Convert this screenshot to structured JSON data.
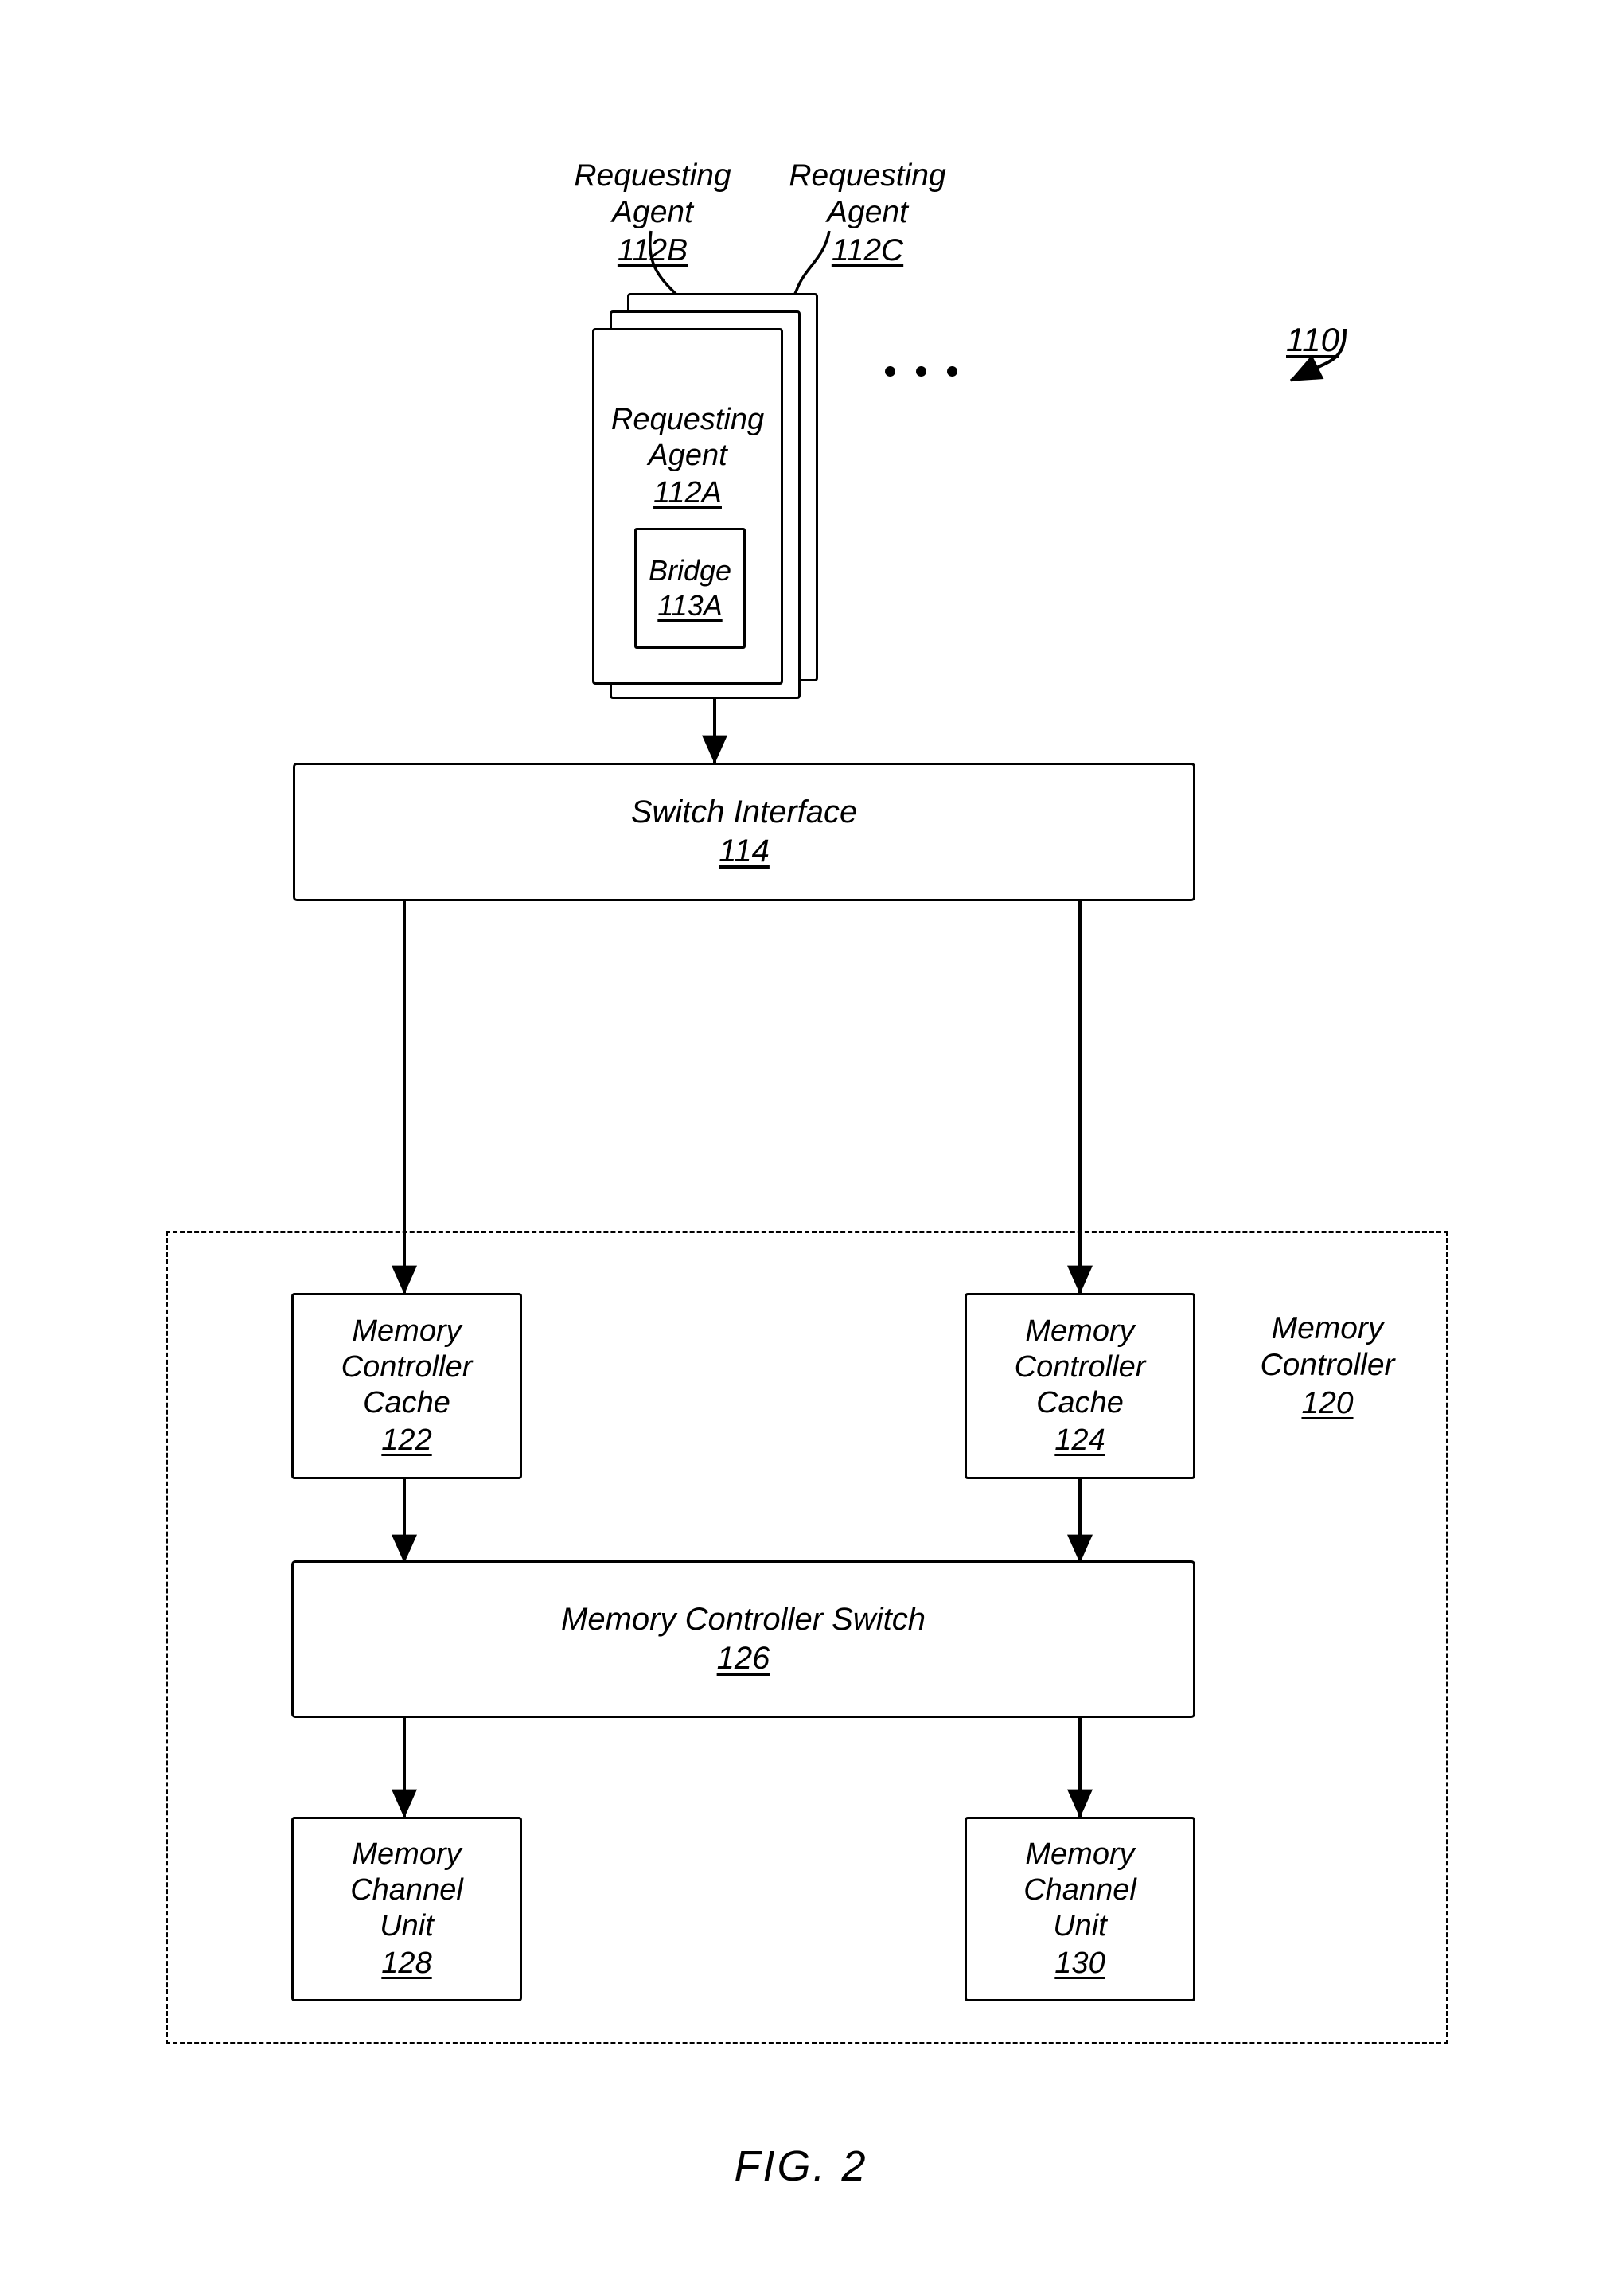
{
  "figure": {
    "caption": "FIG. 2",
    "system_ref": "110"
  },
  "top_labels": [
    {
      "title": "Requesting\nAgent",
      "ref": "112B"
    },
    {
      "title": "Requesting\nAgent",
      "ref": "112C"
    }
  ],
  "requesting_agent": {
    "title": "Requesting\nAgent",
    "ref": "112A",
    "bridge": {
      "title": "Bridge",
      "ref": "113A"
    },
    "ellipsis": "• • •"
  },
  "switch_interface": {
    "title": "Switch Interface",
    "ref": "114"
  },
  "memory_controller": {
    "title": "Memory\nController",
    "ref": "120",
    "caches": [
      {
        "title": "Memory\nController\nCache",
        "ref": "122"
      },
      {
        "title": "Memory\nController\nCache",
        "ref": "124"
      }
    ],
    "switch": {
      "title": "Memory Controller Switch",
      "ref": "126"
    },
    "channel_units": [
      {
        "title": "Memory\nChannel\nUnit",
        "ref": "128"
      },
      {
        "title": "Memory\nChannel\nUnit",
        "ref": "130"
      }
    ]
  },
  "colors": {
    "ink": "#000000",
    "paper": "#ffffff"
  }
}
